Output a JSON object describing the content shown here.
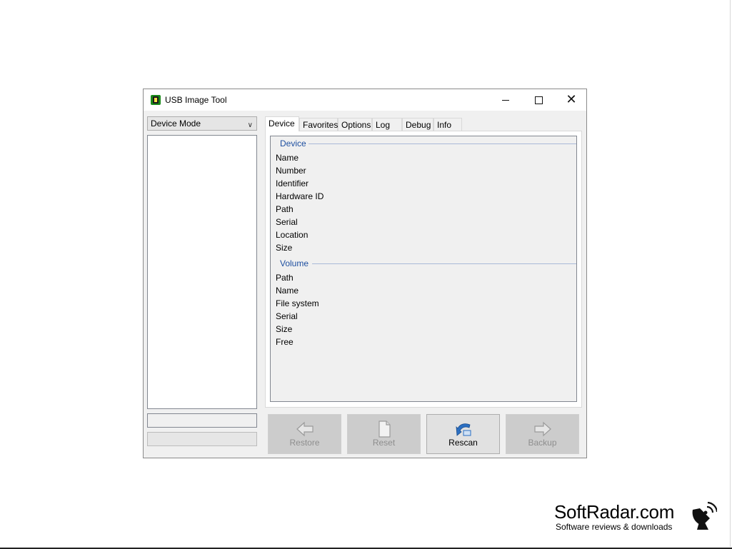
{
  "window": {
    "title": "USB Image Tool",
    "controls": {
      "minimize": "minimize",
      "maximize": "maximize",
      "close": "✕"
    }
  },
  "left_pane": {
    "mode_select": {
      "value": "Device Mode"
    }
  },
  "tabs": [
    {
      "label": "Device",
      "active": true
    },
    {
      "label": "Favorites",
      "active": false
    },
    {
      "label": "Options",
      "active": false
    },
    {
      "label": "Log",
      "active": false
    },
    {
      "label": "Debug",
      "active": false
    },
    {
      "label": "Info",
      "active": false
    }
  ],
  "device_info": {
    "device_group": {
      "title": "Device",
      "fields": [
        "Name",
        "Number",
        "Identifier",
        "Hardware ID",
        "Path",
        "Serial",
        "Location",
        "Size"
      ]
    },
    "volume_group": {
      "title": "Volume",
      "fields": [
        "Path",
        "Name",
        "File system",
        "Serial",
        "Size",
        "Free"
      ]
    }
  },
  "actions": [
    {
      "label": "Restore",
      "icon": "arrow-left-icon",
      "enabled": false
    },
    {
      "label": "Reset",
      "icon": "document-icon",
      "enabled": false
    },
    {
      "label": "Rescan",
      "icon": "rescan-arrow-icon",
      "enabled": true
    },
    {
      "label": "Backup",
      "icon": "arrow-right-icon",
      "enabled": false
    }
  ],
  "watermark": {
    "title": "SoftRadar.com",
    "subtitle": "Software reviews & downloads"
  },
  "colors": {
    "group_header": "#1e4fa0",
    "app_icon": "#1a8a1a",
    "rescan_icon": "#2b6fc2"
  }
}
